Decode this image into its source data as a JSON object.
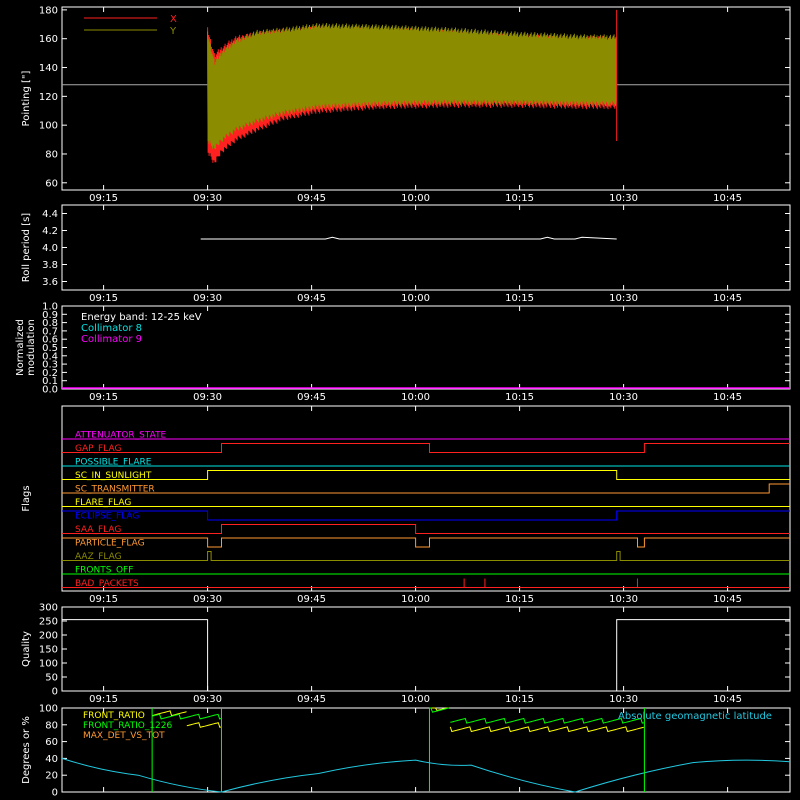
{
  "colors": {
    "background": "#000000",
    "axis": "#ffffff",
    "pointing_x": "#ff2020",
    "pointing_y": "#8c8c00",
    "collimator_8": "#00e5e5",
    "collimator_9": "#ff00ff",
    "front_ratio": "#ffff00",
    "front_ratio_1226": "#00ff00",
    "max_det_vs_tot": "#ff9933",
    "geomag": "#22c8e0"
  },
  "time_axis": {
    "range": [
      "09:09",
      "10:54"
    ],
    "ticks": [
      "09:15",
      "09:30",
      "09:45",
      "10:00",
      "10:15",
      "10:30",
      "10:45"
    ]
  },
  "chart_data": [
    {
      "id": "pointing",
      "type": "line",
      "ylabel": "Pointing [\"]",
      "ylim": [
        55,
        182
      ],
      "yticks": [
        60,
        80,
        100,
        120,
        140,
        160,
        180
      ],
      "legend": [
        {
          "name": "X",
          "color": "#ff2020"
        },
        {
          "name": "Y",
          "color": "#8c8c00"
        }
      ],
      "reference_level": 128,
      "envelope_x": {
        "t": [
          "09:30",
          "09:31",
          "09:32",
          "09:34",
          "09:37",
          "09:41",
          "09:46",
          "09:55",
          "10:05",
          "10:15",
          "10:25",
          "10:29"
        ],
        "upper": [
          168,
          150,
          155,
          162,
          165,
          167,
          169,
          168,
          166,
          163,
          162,
          162
        ],
        "lower": [
          80,
          72,
          80,
          88,
          95,
          103,
          108,
          111,
          112,
          112,
          111,
          111
        ]
      },
      "envelope_y": {
        "t": [
          "09:30",
          "09:31",
          "09:32",
          "09:34",
          "09:37",
          "09:41",
          "09:46",
          "09:55",
          "10:05",
          "10:15",
          "10:25",
          "10:29"
        ],
        "upper": [
          165,
          145,
          152,
          160,
          166,
          168,
          171,
          170,
          168,
          165,
          163,
          163
        ],
        "lower": [
          88,
          82,
          88,
          95,
          101,
          107,
          111,
          113,
          114,
          114,
          113,
          113
        ]
      },
      "end_spike": {
        "t": "10:29",
        "top": 180,
        "bottom": 89
      }
    },
    {
      "id": "roll_period",
      "type": "line",
      "ylabel": "Roll period [s]",
      "ylim": [
        3.5,
        4.5
      ],
      "yticks": [
        3.6,
        3.8,
        4.0,
        4.2,
        4.4
      ],
      "series": [
        {
          "t": [
            "09:29",
            "09:47",
            "09:48",
            "09:49",
            "10:18",
            "10:19",
            "10:20",
            "10:23",
            "10:24",
            "10:29"
          ],
          "values": [
            4.1,
            4.1,
            4.12,
            4.1,
            4.1,
            4.12,
            4.1,
            4.1,
            4.12,
            4.1
          ]
        }
      ]
    },
    {
      "id": "modulation",
      "type": "line",
      "ylabel": "Normalized modulation",
      "ylim": [
        0.0,
        1.0
      ],
      "yticks": [
        0.0,
        0.1,
        0.2,
        0.3,
        0.4,
        0.5,
        0.6,
        0.7,
        0.8,
        0.9,
        1.0
      ],
      "annotations": [
        "Energy band: 12-25 keV",
        "Collimator 8",
        "Collimator 9"
      ],
      "series": [
        {
          "name": "Collimator 9",
          "t": [
            "09:09",
            "10:54"
          ],
          "values": [
            0.0,
            0.0
          ]
        }
      ]
    },
    {
      "id": "flags",
      "type": "line",
      "ylabel": "Flags",
      "flags": [
        {
          "name": "ATTENUATOR_STATE",
          "color": "#ff00ff",
          "steps": [
            [
              "09:09",
              0
            ]
          ]
        },
        {
          "name": "GAP_FLAG",
          "color": "#ff2020",
          "steps": [
            [
              "09:09",
              0
            ],
            [
              "09:32",
              1
            ],
            [
              "10:02",
              0
            ],
            [
              "10:33",
              1
            ]
          ]
        },
        {
          "name": "POSSIBLE_FLARE",
          "color": "#00e5e5",
          "steps": [
            [
              "09:09",
              0
            ]
          ]
        },
        {
          "name": "SC_IN_SUNLIGHT",
          "color": "#ffff00",
          "steps": [
            [
              "09:09",
              0
            ],
            [
              "09:30",
              1
            ],
            [
              "10:29",
              0
            ]
          ]
        },
        {
          "name": "SC_TRANSMITTER",
          "color": "#ff9933",
          "steps": [
            [
              "09:09",
              0
            ],
            [
              "10:51",
              1
            ]
          ]
        },
        {
          "name": "FLARE_FLAG",
          "color": "#ffff00",
          "steps": [
            [
              "09:09",
              0
            ]
          ]
        },
        {
          "name": "ECLIPSE_FLAG",
          "color": "#0000ff",
          "steps": [
            [
              "09:09",
              1
            ],
            [
              "09:30",
              0
            ],
            [
              "10:29",
              1
            ]
          ]
        },
        {
          "name": "SAA_FLAG",
          "color": "#ff2020",
          "steps": [
            [
              "09:09",
              0
            ],
            [
              "09:32",
              1
            ],
            [
              "10:00",
              0
            ]
          ]
        },
        {
          "name": "PARTICLE_FLAG",
          "color": "#ff9933",
          "steps": [
            [
              "09:09",
              1
            ],
            [
              "09:30",
              0
            ],
            [
              "09:32",
              1
            ],
            [
              "10:00",
              0
            ],
            [
              "10:02",
              1
            ],
            [
              "10:32",
              0
            ],
            [
              "10:33",
              1
            ]
          ]
        },
        {
          "name": "AAZ_FLAG",
          "color": "#8c8c00",
          "steps": [
            [
              "09:09",
              0
            ],
            [
              "09:30",
              1
            ],
            [
              "09:30.5",
              0
            ],
            [
              "10:29",
              1
            ],
            [
              "10:29.5",
              0
            ]
          ]
        },
        {
          "name": "FRONTS_OFF",
          "color": "#00ff00",
          "steps": [
            [
              "09:09",
              0
            ]
          ]
        },
        {
          "name": "BAD_PACKETS",
          "color": "#ff2020",
          "steps": [
            [
              "09:09",
              0
            ]
          ],
          "spikes": [
            "10:07",
            "10:10",
            "10:32"
          ]
        }
      ]
    },
    {
      "id": "quality",
      "type": "line",
      "ylabel": "Quality",
      "ylim": [
        0,
        300
      ],
      "yticks": [
        0,
        50,
        100,
        150,
        200,
        250,
        300
      ],
      "series": [
        {
          "t": [
            "09:09",
            "09:30",
            "09:30",
            "10:29",
            "10:29",
            "10:54"
          ],
          "values": [
            255,
            255,
            0,
            0,
            255,
            255
          ]
        }
      ]
    },
    {
      "id": "ratios",
      "type": "line",
      "ylabel": "Degrees or %",
      "ylim": [
        0,
        100
      ],
      "yticks": [
        0,
        20,
        40,
        60,
        80,
        100
      ],
      "legend": [
        {
          "name": "FRONT_RATIO",
          "color": "#ffff00"
        },
        {
          "name": "FRONT_RATIO_1226",
          "color": "#00ff00"
        },
        {
          "name": "MAX_DET_VS_TOT",
          "color": "#ff9933"
        }
      ],
      "annotation": "Absolute geomagnetic latitude",
      "geomag": {
        "t": [
          "09:09",
          "09:20",
          "09:32",
          "09:46",
          "10:00",
          "10:08",
          "10:23",
          "10:40",
          "10:54"
        ],
        "values": [
          40,
          20,
          0,
          22,
          38,
          32,
          0,
          35,
          36
        ]
      },
      "front_ratio": {
        "segments": [
          {
            "t": [
              "09:22",
              "09:27"
            ],
            "value": 94
          },
          {
            "t": [
              "09:27",
              "09:32"
            ],
            "value": 80
          },
          {
            "t": [
              "10:02",
              "10:05"
            ],
            "value": 100
          },
          {
            "t": [
              "10:05",
              "10:33"
            ],
            "value": 75
          }
        ]
      },
      "front_ratio_1226": {
        "segments": [
          {
            "t": [
              "09:22",
              "09:32"
            ],
            "value": 90
          },
          {
            "t": [
              "10:02",
              "10:05"
            ],
            "value": 98
          },
          {
            "t": [
              "10:05",
              "10:33"
            ],
            "value": 85
          }
        ],
        "drops": [
          "09:22",
          "09:32",
          "10:02",
          "10:33"
        ]
      }
    }
  ]
}
